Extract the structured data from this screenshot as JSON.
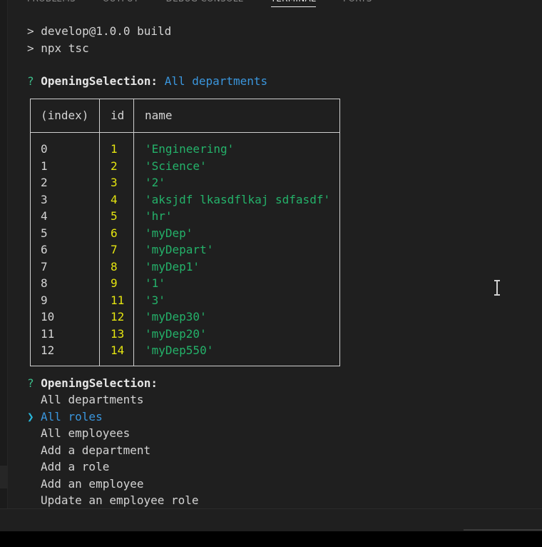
{
  "panel": {
    "tabs": [
      "PROBLEMS",
      "OUTPUT",
      "DEBUG CONSOLE",
      "TERMINAL",
      "PORTS"
    ],
    "active_tab": "TERMINAL"
  },
  "terminal": {
    "script_lines": [
      "develop@1.0.0 build",
      "npx tsc"
    ],
    "prompt_prefix": "?",
    "prompt_label": "OpeningSelection:",
    "first_answer": "All departments",
    "table": {
      "headers": [
        "(index)",
        "id",
        "name"
      ],
      "rows": [
        {
          "index": "0",
          "id": "1",
          "name": "'Engineering'"
        },
        {
          "index": "1",
          "id": "2",
          "name": "'Science'"
        },
        {
          "index": "2",
          "id": "3",
          "name": "'2'"
        },
        {
          "index": "3",
          "id": "4",
          "name": "'aksjdf lkasdflkaj sdfasdf'"
        },
        {
          "index": "4",
          "id": "5",
          "name": "'hr'"
        },
        {
          "index": "5",
          "id": "6",
          "name": "'myDep'"
        },
        {
          "index": "6",
          "id": "7",
          "name": "'myDepart'"
        },
        {
          "index": "7",
          "id": "8",
          "name": "'myDep1'"
        },
        {
          "index": "8",
          "id": "9",
          "name": "'1'"
        },
        {
          "index": "9",
          "id": "11",
          "name": "'3'"
        },
        {
          "index": "10",
          "id": "12",
          "name": "'myDep30'"
        },
        {
          "index": "11",
          "id": "13",
          "name": "'myDep20'"
        },
        {
          "index": "12",
          "id": "14",
          "name": "'myDep550'"
        }
      ]
    },
    "menu_pointer": "❯",
    "menu_options": [
      "All departments",
      "All roles",
      "All employees",
      "Add a department",
      "Add a role",
      "Add an employee",
      "Update an employee role"
    ],
    "selected_option_index": 1
  },
  "colors": {
    "background": "#1f1f1f",
    "text": "#cccccc",
    "string_green": "#24b26a",
    "number_yellow": "#e5e510",
    "answer_cyan": "#3a96dd",
    "prompt_green": "#3dbd8a",
    "table_border": "#cfcfcf"
  },
  "icons": [
    "chevron-right-icon",
    "question-mark-icon",
    "text-cursor-icon"
  ]
}
